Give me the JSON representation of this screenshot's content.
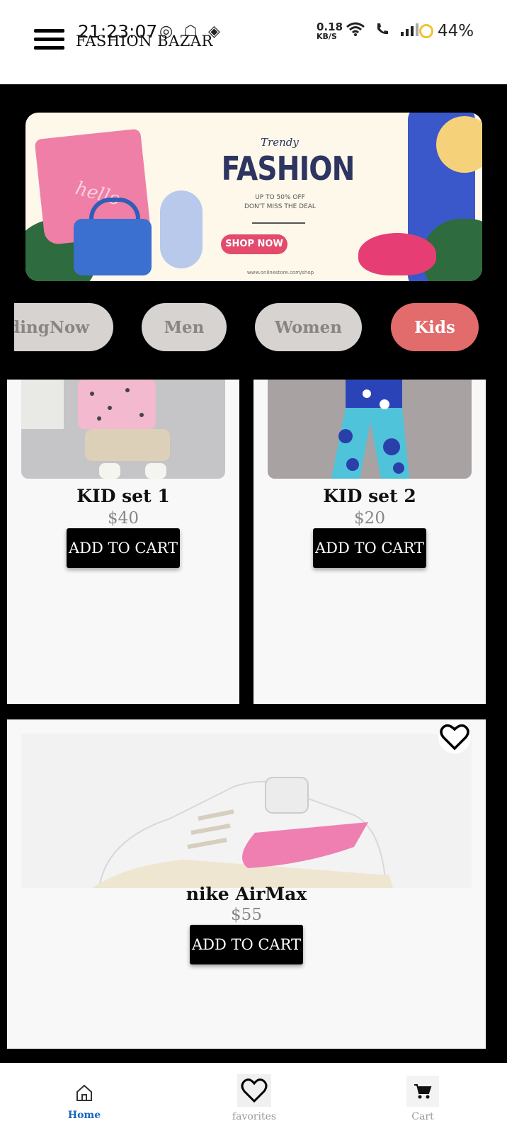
{
  "status_bar": {
    "time": "21:23:07",
    "network_speed": "0.18",
    "network_unit": "KB/S",
    "battery": "44%"
  },
  "app_bar": {
    "title": "FASHION BAZAR"
  },
  "banner": {
    "script_text": "Trendy",
    "title": "FASHION",
    "subtitle_line1": "UP TO 50% OFF",
    "subtitle_line2": "DON'T MISS THE DEAL",
    "button": "SHOP NOW",
    "url": "www.onlinestore.com/shop",
    "shirt_text": "hello"
  },
  "categories": [
    {
      "label": "TrendingNow",
      "active": false
    },
    {
      "label": "Men",
      "active": false
    },
    {
      "label": "Women",
      "active": false
    },
    {
      "label": "Kids",
      "active": true
    }
  ],
  "products": [
    {
      "name": "KID set 1",
      "price": "$40",
      "button": "ADD TO CART"
    },
    {
      "name": "KID set 2",
      "price": "$20",
      "button": "ADD TO CART"
    },
    {
      "name": "nike AirMax",
      "price": "$55",
      "button": "ADD TO CART"
    }
  ],
  "bottom_nav": {
    "home": "Home",
    "favorites": "favorites",
    "cart": "Cart"
  },
  "colors": {
    "accent_chip": "#e26b6b",
    "nav_active": "#1565c0"
  }
}
